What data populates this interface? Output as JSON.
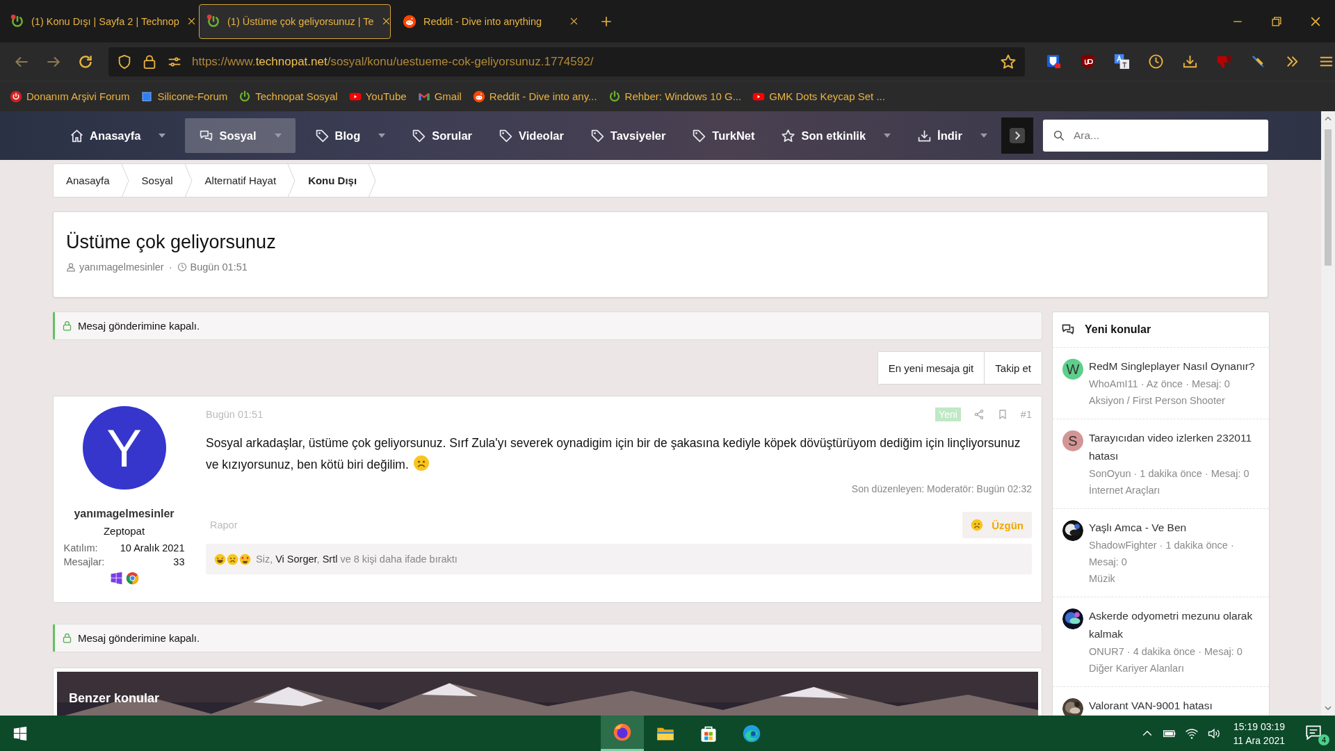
{
  "browser": {
    "tabs": [
      {
        "title": "(1) Konu Dışı | Sayfa 2 | Technop",
        "kind": "power",
        "selected": false
      },
      {
        "title": "(1) Üstüme çok geliyorsunuz | Te",
        "kind": "power",
        "selected": true
      },
      {
        "title": "Reddit - Dive into anything",
        "kind": "reddit",
        "selected": false
      }
    ],
    "url": {
      "scheme": "https://www.",
      "host": "technopat.net",
      "path": "/sosyal/konu/uestueme-cok-geliyorsunuz.1774592/"
    },
    "bookmarks": [
      {
        "label": "Donanım Arşivi Forum",
        "kind": "power-red"
      },
      {
        "label": "Silicone-Forum",
        "kind": "chip"
      },
      {
        "label": "Technopat Sosyal",
        "kind": "power"
      },
      {
        "label": "YouTube",
        "kind": "youtube"
      },
      {
        "label": "Gmail",
        "kind": "gmail"
      },
      {
        "label": "Reddit - Dive into any...",
        "kind": "reddit"
      },
      {
        "label": "Rehber: Windows 10 G...",
        "kind": "power"
      },
      {
        "label": "GMK Dots Keycap Set ...",
        "kind": "youtube"
      }
    ]
  },
  "site_nav": {
    "items": [
      {
        "label": "Anasayfa",
        "kind": "home",
        "dropdown": true,
        "selected": false
      },
      {
        "label": "Sosyal",
        "kind": "chat",
        "dropdown": true,
        "selected": true
      },
      {
        "label": "Blog",
        "kind": "tag",
        "dropdown": true,
        "selected": false
      },
      {
        "label": "Sorular",
        "kind": "tag",
        "dropdown": false,
        "selected": false
      },
      {
        "label": "Videolar",
        "kind": "tag",
        "dropdown": false,
        "selected": false
      },
      {
        "label": "Tavsiyeler",
        "kind": "tag",
        "dropdown": false,
        "selected": false
      },
      {
        "label": "TurkNet",
        "kind": "tag",
        "dropdown": false,
        "selected": false
      },
      {
        "label": "Son etkinlik",
        "kind": "star",
        "dropdown": true,
        "selected": false
      },
      {
        "label": "İndir",
        "kind": "download",
        "dropdown": true,
        "selected": false
      }
    ],
    "search": {
      "placeholder": "Ara..."
    }
  },
  "breadcrumbs": [
    {
      "label": "Anasayfa",
      "current": false
    },
    {
      "label": "Sosyal",
      "current": false
    },
    {
      "label": "Alternatif Hayat",
      "current": false
    },
    {
      "label": "Konu Dışı",
      "current": true
    }
  ],
  "thread": {
    "title": "Üstüme çok geliyorsunuz",
    "author": "yanımagelmesinler",
    "separator": "·",
    "time": "Bugün 01:51"
  },
  "notice_top": "Mesaj gönderimine kapalı.",
  "thread_buttons": [
    "En yeni mesaja git",
    "Takip et"
  ],
  "post": {
    "user": {
      "letter": "Y",
      "color": "#3636cc",
      "name": "yanımagelmesinler",
      "title": "Zeptopat",
      "stats": [
        {
          "label": "Katılım:",
          "value": "10 Aralık 2021"
        },
        {
          "label": "Mesajlar:",
          "value": "33"
        }
      ]
    },
    "date": "Bugün 01:51",
    "badge": "Yeni",
    "number": "#1",
    "body": "Sosyal arkadaşlar, üstüme çok geliyorsunuz. Sırf Zula'yı severek oynadigim için bir de şakasına kediyle köpek dövüştürüyom dediğim için linçliyorsunuz ve kızıyorsunuz, ben kötü biri değilim.",
    "edited": "Son düzenleyen: Moderatör: Bugün 02:32",
    "report": "Rapor",
    "reaction_button": "Üzgün",
    "reactions": [
      {
        "text": "Siz, ",
        "kind": "plain"
      },
      {
        "text": "Vi Sorger",
        "kind": "link"
      },
      {
        "text": ", ",
        "kind": "plain"
      },
      {
        "text": "Srtl",
        "kind": "link"
      },
      {
        "text": " ve 8 kişi daha ifade bıraktı",
        "kind": "plain"
      }
    ]
  },
  "notice_bottom": "Mesaj gönderimine kapalı.",
  "similar": {
    "title": "Benzer konular"
  },
  "sidebar": {
    "title": "Yeni konular",
    "items": [
      {
        "title": "RedM Singleplayer Nasıl Oynanır?",
        "meta": "WhoAmI11 · Az önce · Mesaj: 0",
        "forum": "Aksiyon / First Person Shooter",
        "avatar": {
          "kind": "letter",
          "letter": "W",
          "color": "#5ccf8a"
        }
      },
      {
        "title": "Tarayıcıdan video izlerken 232011 hatası",
        "meta": "SonOyun · 1 dakika önce · Mesaj: 0",
        "forum": "İnternet Araçları",
        "avatar": {
          "kind": "letter",
          "letter": "S",
          "color": "#d49595"
        }
      },
      {
        "title": "Yaşlı Amca - Ve Ben",
        "meta": "ShadowFighter · 1 dakika önce · Mesaj: 0",
        "forum": "Müzik"
      },
      {
        "title": "Askerde odyometri mezunu olarak kalmak",
        "meta": "ONUR7 · 4 dakika önce · Mesaj: 0",
        "forum": "Diğer Kariyer Alanları"
      },
      {
        "title": "Valorant VAN-9001 hatası"
      }
    ]
  },
  "taskbar": {
    "apps": [
      {
        "kind": "firefox",
        "selected": true
      },
      {
        "kind": "folder",
        "selected": false
      },
      {
        "kind": "store",
        "selected": false
      },
      {
        "kind": "edge",
        "selected": false
      }
    ],
    "time": "15:19 03:19",
    "date": "11 Ara 2021",
    "notifications": "4"
  }
}
